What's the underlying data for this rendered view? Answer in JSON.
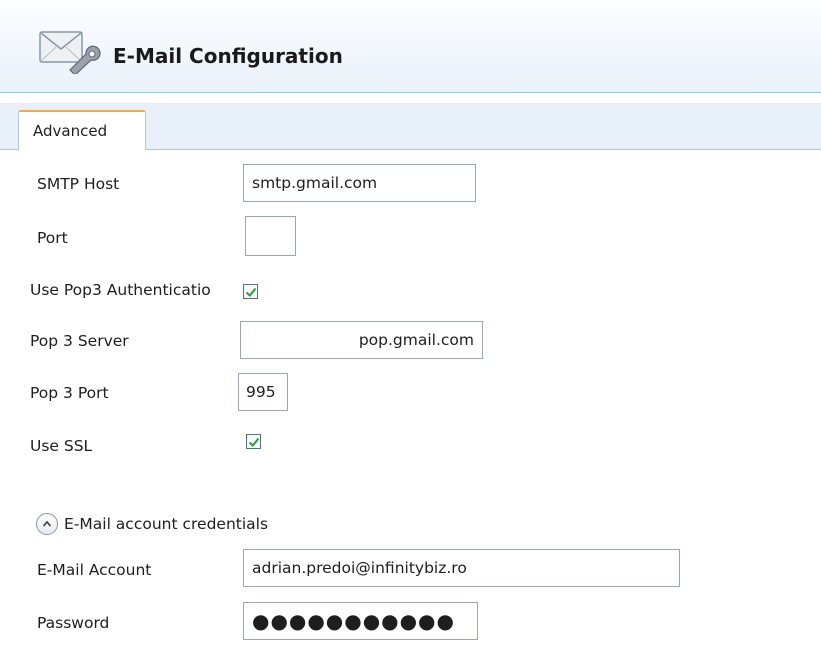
{
  "header": {
    "title": "E-Mail Configuration",
    "icon": "email-settings-icon"
  },
  "tabs": [
    {
      "label": "Advanced",
      "selected": true
    }
  ],
  "form": {
    "smtp_host": {
      "label": "SMTP Host",
      "value": "smtp.gmail.com"
    },
    "port": {
      "label": "Port",
      "value": ""
    },
    "use_pop3": {
      "label": "Use Pop3 Authenticatio",
      "checked": true
    },
    "pop3_server": {
      "label": "Pop 3 Server",
      "value": "pop.gmail.com"
    },
    "pop3_port": {
      "label": "Pop 3 Port",
      "value": "995"
    },
    "use_ssl": {
      "label": "Use SSL",
      "checked": true
    }
  },
  "credentials": {
    "section_label": "E-Mail account credentials",
    "email_account": {
      "label": "E-Mail Account",
      "value": "adrian.predoi@infinitybiz.ro"
    },
    "password": {
      "label": "Password",
      "value": "●●●●●●●●●●●"
    }
  },
  "colors": {
    "tab_accent": "#f0a84a",
    "header_border": "#a7c0db",
    "check_mark": "#2e9b3a"
  }
}
